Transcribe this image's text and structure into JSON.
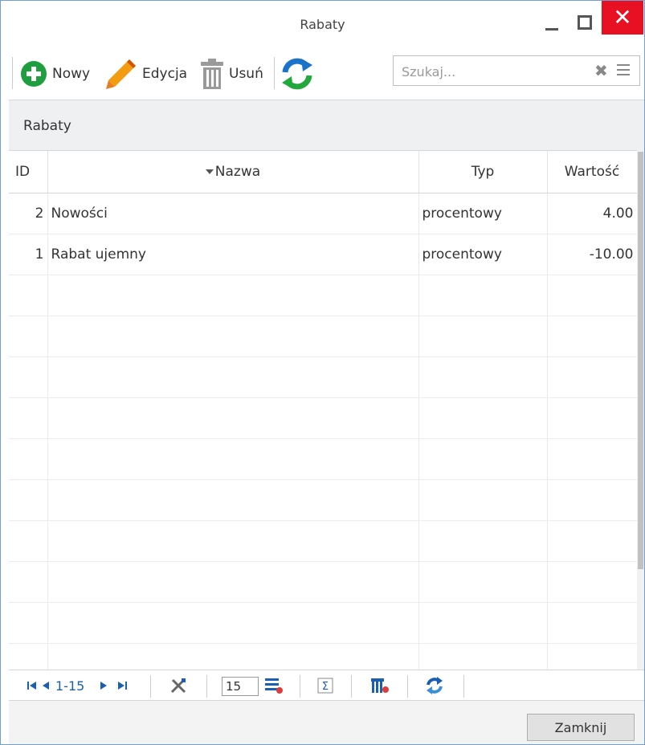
{
  "window": {
    "title": "Rabaty",
    "close_glyph": "✕"
  },
  "toolbar": {
    "new_label": "Nowy",
    "edit_label": "Edycja",
    "delete_label": "Usuń",
    "search_placeholder": "Szukaj...",
    "search_clear_glyph": "✖"
  },
  "panel": {
    "title": "Rabaty"
  },
  "grid": {
    "columns": [
      "ID",
      "Nazwa",
      "Typ",
      "Wartość"
    ],
    "rows": [
      {
        "id": "2",
        "nazwa": "Nowości",
        "typ": "procentowy",
        "wartosc": "4.00"
      },
      {
        "id": "1",
        "nazwa": "Rabat ujemny",
        "typ": "procentowy",
        "wartosc": "-10.00"
      }
    ]
  },
  "pager": {
    "range": "1-15",
    "page_size": "15"
  },
  "footer": {
    "close_label": "Zamknij"
  },
  "colors": {
    "accent_blue": "#1a5fb4",
    "add_green": "#1e9e3e",
    "close_red": "#e81123",
    "pencil_orange": "#f39c12"
  }
}
